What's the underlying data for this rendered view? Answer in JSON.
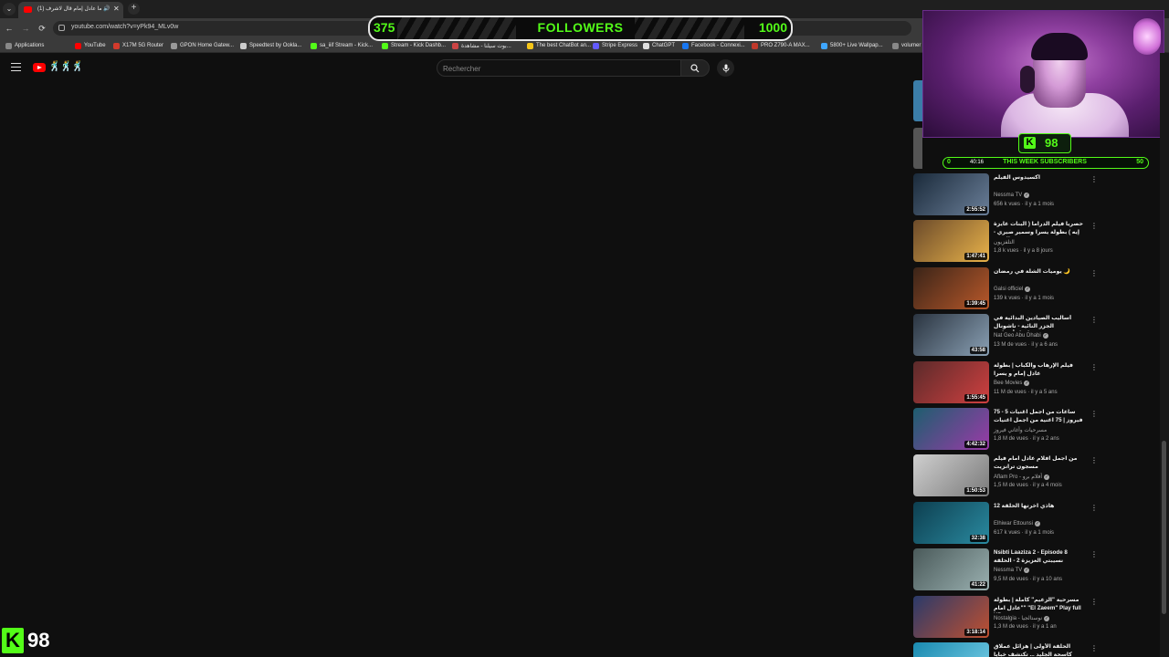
{
  "browser": {
    "tab_title": "(1) لما عادل إمام قال لاشرف",
    "new_tab_symbol": "+",
    "close_symbol": "✕",
    "url": "youtube.com/watch?v=yPk94_MLv0w"
  },
  "bookmarks": [
    {
      "label": "Applications",
      "color": "#888888"
    },
    {
      "label": "YouTube",
      "color": "#ff0000"
    },
    {
      "label": "X17M 5G Router",
      "color": "#d33a2c"
    },
    {
      "label": "GPON Home Gatew...",
      "color": "#999999"
    },
    {
      "label": "Speedtest by Ookla...",
      "color": "#cccccc"
    },
    {
      "label": "sa_iiif Stream - Kick...",
      "color": "#53fc18"
    },
    {
      "label": "Stream - Kick Dashb...",
      "color": "#53fc18"
    },
    {
      "label": "بوت سيلنا - مشاهدة...",
      "color": "#c44"
    },
    {
      "label": "The best ChatBot an...",
      "color": "#f5c518"
    },
    {
      "label": "Stripe Express",
      "color": "#635bff"
    },
    {
      "label": "ChatGPT",
      "color": "#dddddd"
    },
    {
      "label": "Facebook - Connexi...",
      "color": "#1877f2"
    },
    {
      "label": "PRO Z790-A MAX...",
      "color": "#c0392b"
    },
    {
      "label": "5800+ Live Wallpap...",
      "color": "#3ea6ff"
    },
    {
      "label": "volumer",
      "color": "#888888"
    }
  ],
  "youtube": {
    "search_placeholder": "Rechercher"
  },
  "follower_goal": {
    "current": "375",
    "label": "FOLLOWERS",
    "target": "1000"
  },
  "kick_badge": {
    "letter": "K",
    "count": "98"
  },
  "sub_goal": {
    "current": "0",
    "label": "THIS WEEK SUBSCRIBERS",
    "target": "50",
    "partial_duration": "40:16"
  },
  "bottom_counter": {
    "letter": "K",
    "count": "98"
  },
  "videos": [
    {
      "title": "اكسيدوس الفيلم",
      "channel": "Nessma TV",
      "verified": true,
      "meta": "656 k vues · il y a 1 mois",
      "duration": "2:55:52",
      "colors": [
        "#1a2a3a",
        "#6b7f99"
      ]
    },
    {
      "title": "حصرياً فيلم الدراما ( البنات عايزة إيه ) بطولة يسرا وسمير صبري - محمود عبدالعزيز ...",
      "channel": "التلفزيون",
      "verified": false,
      "meta": "1,8 k vues · il y a 8 jours",
      "duration": "1:47:41",
      "colors": [
        "#6b4a2a",
        "#e8b24a"
      ]
    },
    {
      "title": "يوميات الشلة في رمضان 🌙",
      "channel": "Galsi officiel",
      "verified": true,
      "meta": "139 k vues · il y a 1 mois",
      "duration": "1:39:45",
      "colors": [
        "#3a2418",
        "#b8582a"
      ]
    },
    {
      "title": "أساليب الصيادين البدائية في الجزر النائية - ناشونال جيوغرافيك أبوظبي",
      "channel": "Nat Geo Abu Dhabi",
      "verified": true,
      "meta": "13 M de vues · il y a 6 ans",
      "duration": "43:58",
      "colors": [
        "#2a3440",
        "#8aa0b4"
      ]
    },
    {
      "title": "فيلم الإرهاب والكباب | بطولة عادل إمام و يسرا",
      "channel": "Bee Movies",
      "verified": true,
      "meta": "11 M de vues · il y a 5 ans",
      "duration": "1:55:45",
      "colors": [
        "#5a2a2a",
        "#d04040"
      ]
    },
    {
      "title": "75 - 5 ساعات من اجمل اغنيات فيروز | 75 اغنية من اجمل اغنيات فيروز ...",
      "channel": "مسرحيات وأغاني فيروز",
      "verified": false,
      "meta": "1,8 M de vues · il y a 2 ans",
      "duration": "4:42:32",
      "colors": [
        "#1d5e6e",
        "#9b3aa8"
      ]
    },
    {
      "title": "من اجمل افلام عادل امام فيلم مسجون ترانزيت",
      "channel": "Aflam Pro - أفلام برو",
      "verified": true,
      "meta": "1,5 M de vues · il y a 4 mois",
      "duration": "1:50:53",
      "colors": [
        "#cfcfcf",
        "#7a7a7a"
      ]
    },
    {
      "title": "هاذي اخرتها الحلقة 12",
      "channel": "Elhiwar Ettounsi",
      "verified": true,
      "meta": "617 k vues · il y a 1 mois",
      "duration": "32:38",
      "colors": [
        "#0d3f50",
        "#2a8aa0"
      ]
    },
    {
      "title": "Nsibti Laaziza 2 - Episode 8 نسيبتي العزيزة 2 - الحلقة",
      "channel": "Nessma TV",
      "verified": true,
      "meta": "9,5 M de vues · il y a 10 ans",
      "duration": "41:22",
      "colors": [
        "#4a5a5a",
        "#9ab0b0"
      ]
    },
    {
      "title": "مسرحية \"الزعيم\" كاملة | بطولة \"عادل امام\" \"El Zaeem\" Play full HD",
      "channel": "Nostalgia - نوستالجيا",
      "verified": true,
      "meta": "1,3 M de vues · il y a 1 an",
      "duration": "3:18:14",
      "colors": [
        "#2a3a6a",
        "#c05030"
      ]
    },
    {
      "title": "الحلقة الأولى | هزائل عملاق كاسحة الجليد ... تكتشف خبايا جزيرة",
      "channel": "",
      "verified": false,
      "meta": "",
      "duration": "",
      "colors": [
        "#1a8ab0",
        "#7ad0e8"
      ]
    }
  ]
}
